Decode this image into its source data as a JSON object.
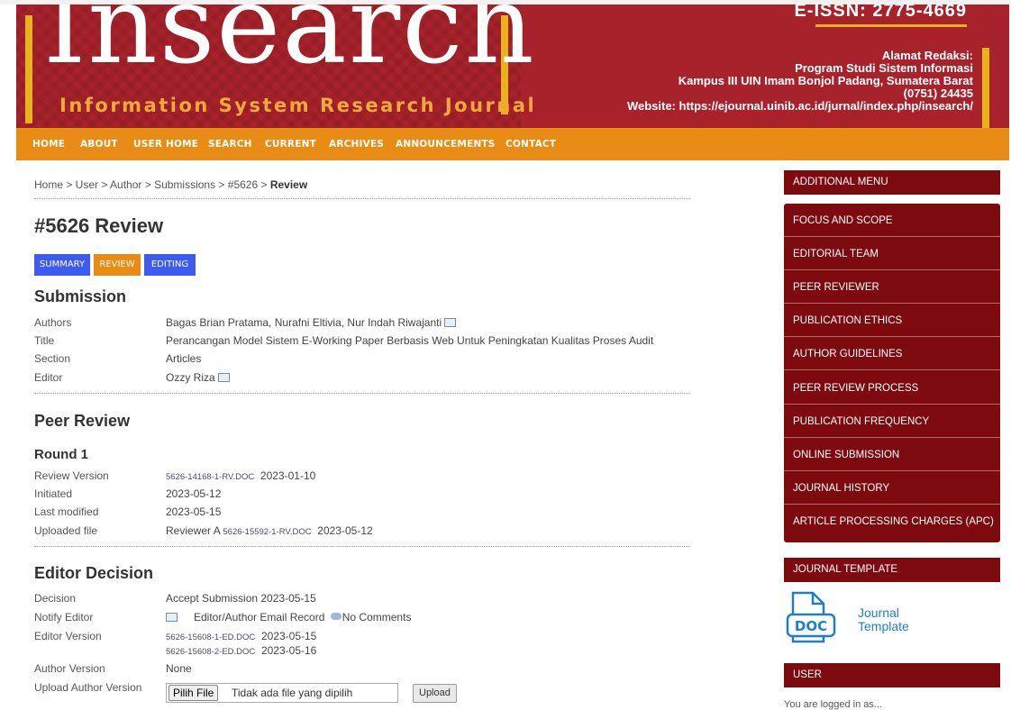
{
  "header": {
    "logo_main": "Insearch",
    "logo_sub": "Information System Research Journal",
    "eissn": "E-ISSN: 2775-4669",
    "address_title": "Alamat Redaksi:",
    "address_line1": "Program Studi Sistem Informasi",
    "address_line2": "Kampus III UIN Imam Bonjol Padang, Sumatera Barat",
    "address_line3": "(0751) 24435",
    "website": "Website: https://ejournal.uinib.ac.id/jurnal/index.php/insearch/"
  },
  "nav": [
    "HOME",
    "ABOUT",
    "USER HOME",
    "SEARCH",
    "CURRENT",
    "ARCHIVES",
    "ANNOUNCEMENTS",
    "CONTACT"
  ],
  "breadcrumb": {
    "path": "Home > User > Author > Submissions > #5626 > ",
    "current": "Review"
  },
  "page": {
    "title": "#5626 Review",
    "tabs": [
      "SUMMARY",
      "REVIEW",
      "EDITING"
    ]
  },
  "submission": {
    "heading": "Submission",
    "labels": [
      "Authors",
      "Title",
      "Section",
      "Editor"
    ],
    "authors": "Bagas Brian Pratama, Nurafni Eltivia, Nur Indah Riwajanti",
    "title": "Perancangan Model Sistem E-Working Paper Berbasis Web Untuk Peningkatan Kualitas Proses Audit",
    "section": "Articles",
    "editor": "Ozzy Riza"
  },
  "peer_review": {
    "heading": "Peer Review",
    "round": "Round 1",
    "labels": [
      "Review Version",
      "Initiated",
      "Last modified",
      "Uploaded file"
    ],
    "review_version_file": "5626-14168-1-RV.DOC",
    "review_version_date": "2023-01-10",
    "initiated": "2023-05-12",
    "last_modified": "2023-05-15",
    "uploaded_prefix": "Reviewer A",
    "uploaded_file": "5626-15592-1-RV.DOC",
    "uploaded_date": "2023-05-12"
  },
  "editor_decision": {
    "heading": "Editor Decision",
    "labels": [
      "Decision",
      "Notify Editor",
      "Editor Version",
      "Author Version",
      "Upload Author Version"
    ],
    "decision": "Accept Submission 2023-05-15",
    "email_record": "Editor/Author Email Record",
    "no_comments": "No Comments",
    "editor_file1": "5626-15608-1-ED.DOC",
    "editor_date1": "2023-05-15",
    "editor_file2": "5626-15608-2-ED.DOC",
    "editor_date2": "2023-05-16",
    "author_version": "None",
    "choose_file": "Pilih File",
    "no_file": "Tidak ada file yang dipilih",
    "upload": "Upload"
  },
  "sidebar": {
    "additional_menu": "ADDITIONAL MENU",
    "menu_items": [
      "FOCUS AND SCOPE",
      "EDITORIAL TEAM",
      "PEER REVIEWER",
      "PUBLICATION ETHICS",
      "AUTHOR GUIDELINES",
      "PEER REVIEW PROCESS",
      "PUBLICATION FREQUENCY",
      "ONLINE SUBMISSION",
      "JOURNAL HISTORY",
      "ARTICLE PROCESSING CHARGES (APC)"
    ],
    "journal_template": "JOURNAL TEMPLATE",
    "template_icon_text": "DOC",
    "template_line1": "Journal",
    "template_line2": "Template",
    "user": "USER",
    "logged_in": "You are logged in as..."
  },
  "colors": {
    "header_red": "#a8222b",
    "nav_orange": "#e98c15",
    "sidebar_maroon": "#7d0a0f",
    "tab_blue": "#3d5bf0",
    "tab_orange": "#e98c15",
    "accent_gold": "#e8b21a"
  }
}
